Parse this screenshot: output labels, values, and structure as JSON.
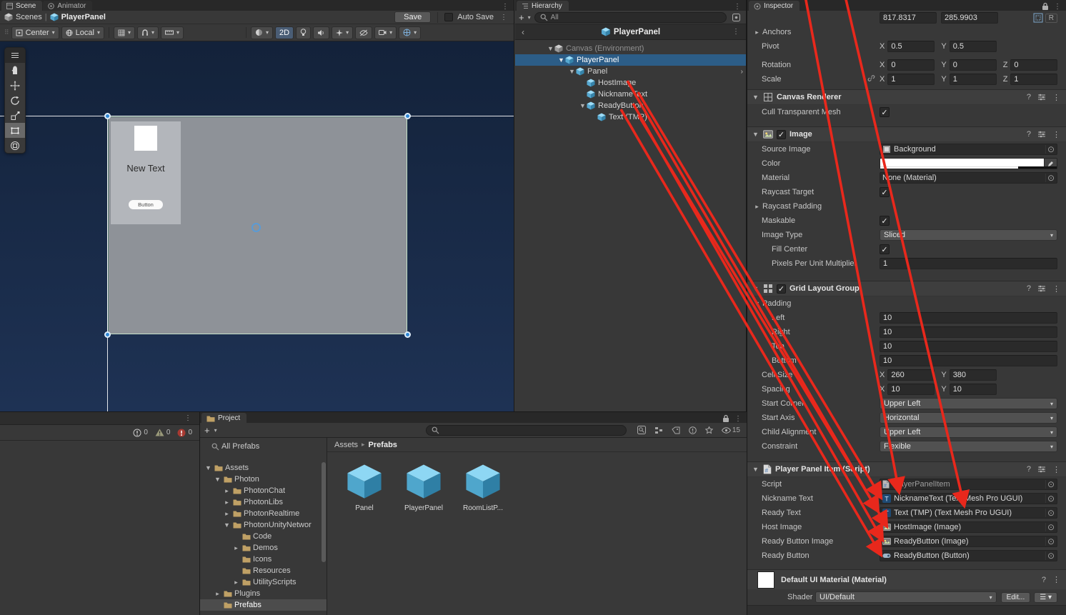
{
  "scene": {
    "tabs": [
      "Scene",
      "Animator"
    ],
    "breadcrumb_root": "Scenes",
    "breadcrumb_current": "PlayerPanel",
    "save_label": "Save",
    "auto_save_label": "Auto Save",
    "pivot_mode": "Center",
    "space_mode": "Local",
    "mode_2d": "2D",
    "canvas": {
      "item_title": "New Text",
      "item_button": "Button"
    }
  },
  "console": {
    "info_count": "0",
    "warning_count": "0",
    "error_count": "0"
  },
  "hierarchy": {
    "tab": "Hierarchy",
    "search_value": "All",
    "isolation_title": "PlayerPanel",
    "items": [
      {
        "label": "Canvas (Environment)"
      },
      {
        "label": "PlayerPanel"
      },
      {
        "label": "Panel"
      },
      {
        "label": "HostImage"
      },
      {
        "label": "NicknameText"
      },
      {
        "label": "ReadyButton"
      },
      {
        "label": "Text (TMP)"
      }
    ]
  },
  "project": {
    "tab": "Project",
    "favorites_item": "All Prefabs",
    "tree": [
      {
        "label": "Assets"
      },
      {
        "label": "Photon"
      },
      {
        "label": "PhotonChat"
      },
      {
        "label": "PhotonLibs"
      },
      {
        "label": "PhotonRealtime"
      },
      {
        "label": "PhotonUnityNetwor"
      },
      {
        "label": "Code"
      },
      {
        "label": "Demos"
      },
      {
        "label": "Icons"
      },
      {
        "label": "Resources"
      },
      {
        "label": "UtilityScripts"
      },
      {
        "label": "Plugins"
      },
      {
        "label": "Prefabs"
      }
    ],
    "breadcrumb": [
      "Assets",
      "Prefabs"
    ],
    "visible_count": "15",
    "assets": [
      {
        "name": "Panel"
      },
      {
        "name": "PlayerPanel"
      },
      {
        "name": "RoomListP..."
      }
    ]
  },
  "inspector": {
    "tab": "Inspector",
    "pos_x": "817.8317",
    "pos_y": "285.9903",
    "raw_edit": "R",
    "anchors_label": "Anchors",
    "pivot_label": "Pivot",
    "pivot_x": "0.5",
    "pivot_y": "0.5",
    "rotation_label": "Rotation",
    "rotation_x": "0",
    "rotation_y": "0",
    "rotation_z": "0",
    "scale_label": "Scale",
    "scale_x": "1",
    "scale_y": "1",
    "scale_z": "1",
    "canvas_renderer": {
      "title": "Canvas Renderer",
      "cull_label": "Cull Transparent Mesh"
    },
    "image": {
      "title": "Image",
      "source_label": "Source Image",
      "source_value": "Background",
      "color_label": "Color",
      "material_label": "Material",
      "material_value": "None (Material)",
      "raycast_target_label": "Raycast Target",
      "raycast_padding_label": "Raycast Padding",
      "maskable_label": "Maskable",
      "image_type_label": "Image Type",
      "image_type_value": "Sliced",
      "fill_center_label": "Fill Center",
      "ppu_label": "Pixels Per Unit Multiplier",
      "ppu_value": "1"
    },
    "grid": {
      "title": "Grid Layout Group",
      "padding_label": "Padding",
      "rows": [
        {
          "label": "Left",
          "value": "10"
        },
        {
          "label": "Right",
          "value": "10"
        },
        {
          "label": "Top",
          "value": "10"
        },
        {
          "label": "Bottom",
          "value": "10"
        }
      ],
      "cell_size_label": "Cell Size",
      "cell_x": "260",
      "cell_y": "380",
      "spacing_label": "Spacing",
      "spacing_x": "10",
      "spacing_y": "10",
      "start_corner_label": "Start Corner",
      "start_corner_value": "Upper Left",
      "start_axis_label": "Start Axis",
      "start_axis_value": "Horizontal",
      "child_alignment_label": "Child Alignment",
      "child_alignment_value": "Upper Left",
      "constraint_label": "Constraint",
      "constraint_value": "Flexible"
    },
    "script": {
      "title": "Player Panel Item (Script)",
      "rows": [
        {
          "label": "Script",
          "value": "PlayerPanelItem"
        },
        {
          "label": "Nickname Text",
          "value": "NicknameText (Text Mesh Pro UGUI)"
        },
        {
          "label": "Ready Text",
          "value": "Text (TMP) (Text Mesh Pro UGUI)"
        },
        {
          "label": "Host Image",
          "value": "HostImage (Image)"
        },
        {
          "label": "Ready Button Image",
          "value": "ReadyButton (Image)"
        },
        {
          "label": "Ready Button",
          "value": "ReadyButton (Button)"
        }
      ]
    },
    "material": {
      "title": "Default UI Material (Material)",
      "shader_label": "Shader",
      "shader_value": "UI/Default",
      "edit_label": "Edit..."
    }
  },
  "annotation": {
    "arrow_color": "#e8281c"
  }
}
